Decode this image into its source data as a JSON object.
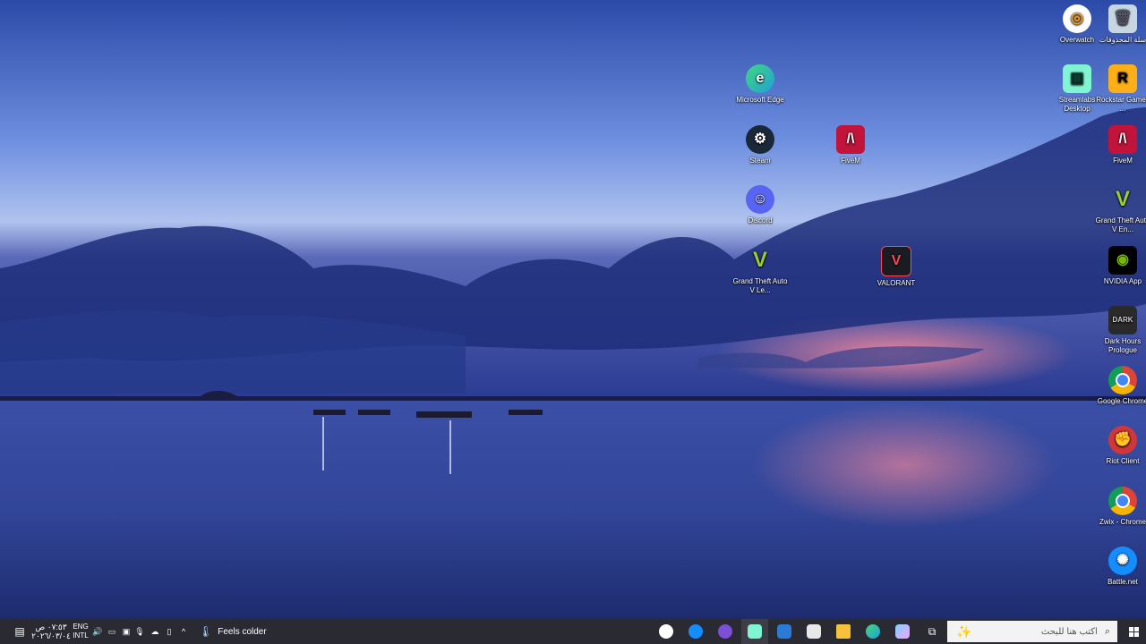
{
  "desktop_icons": [
    {
      "id": "overwatch",
      "label": "Overwatch",
      "icon": "overwatch-icon",
      "color": "#f99e1a"
    },
    {
      "id": "recycle",
      "label": "سلة المحذوفات",
      "icon": "recycle-bin-icon",
      "color": "#9fb6c8"
    },
    {
      "id": "edge",
      "label": "Microsoft Edge",
      "icon": "edge-icon",
      "color": "#1fa0d8"
    },
    {
      "id": "streamlabs",
      "label": "Streamlabs Desktop",
      "icon": "streamlabs-icon",
      "color": "#80f5d2"
    },
    {
      "id": "rockstar",
      "label": "Rockstar Games ...",
      "icon": "rockstar-icon",
      "color": "#fcaf17"
    },
    {
      "id": "steam",
      "label": "Steam",
      "icon": "steam-icon",
      "color": "#1b2838"
    },
    {
      "id": "fivem-mid",
      "label": "FiveM",
      "icon": "fivem-icon",
      "color": "#c2133a"
    },
    {
      "id": "fivem-right",
      "label": "FiveM",
      "icon": "fivem-icon",
      "color": "#c2133a"
    },
    {
      "id": "discord",
      "label": "Discord",
      "icon": "discord-icon",
      "color": "#5865f2"
    },
    {
      "id": "gta-right",
      "label": "Grand Theft Auto V En...",
      "icon": "gta-icon",
      "color": "#2b3b1a"
    },
    {
      "id": "gta-mid",
      "label": "Grand Theft Auto V Le...",
      "icon": "gta-icon",
      "color": "#2b3b1a"
    },
    {
      "id": "valorant",
      "label": "VALORANT",
      "icon": "valorant-icon",
      "color": "#ff4655"
    },
    {
      "id": "nvidia",
      "label": "NVIDIA App",
      "icon": "nvidia-icon",
      "color": "#76b900"
    },
    {
      "id": "darkhours",
      "label": "Dark Hours Prologue",
      "icon": "darkhours-icon",
      "color": "#2a2a2a"
    },
    {
      "id": "chrome",
      "label": "Google Chrome",
      "icon": "chrome-icon",
      "color": "#db4437"
    },
    {
      "id": "riot",
      "label": "Riot Client",
      "icon": "riot-icon",
      "color": "#d13639"
    },
    {
      "id": "chrome2",
      "label": "Zwix - Chrome",
      "icon": "chrome-icon",
      "color": "#db4437"
    },
    {
      "id": "battlenet",
      "label": "Battle.net",
      "icon": "battlenet-icon",
      "color": "#148eff"
    }
  ],
  "taskbar": {
    "search_placeholder": "اكتب هنا للبحث",
    "weather": "Feels colder",
    "lang_line1": "ENG",
    "lang_line2": "INTL",
    "time": "٠٧:٥٣ ص",
    "date": "٢٠٢٦/٠٣/٠٤",
    "apps": [
      {
        "name": "overwatch",
        "icon": "overwatch-icon",
        "color": "#f99e1a"
      },
      {
        "name": "battlenet",
        "icon": "battlenet-icon",
        "color": "#148eff"
      },
      {
        "name": "app-purple",
        "icon": "app-icon",
        "color": "#7b4fd6"
      },
      {
        "name": "streamlabs",
        "icon": "streamlabs-icon",
        "color": "#80f5d2"
      },
      {
        "name": "mail",
        "icon": "mail-icon",
        "color": "#2a7ad6"
      },
      {
        "name": "store",
        "icon": "store-icon",
        "color": "#e8e8e8"
      },
      {
        "name": "file-explorer",
        "icon": "folder-icon",
        "color": "#f6c23c"
      },
      {
        "name": "edge",
        "icon": "edge-icon",
        "color": "#1fa0d8"
      },
      {
        "name": "copilot",
        "icon": "copilot-icon",
        "color": "#7fd1ff"
      },
      {
        "name": "task-view",
        "icon": "task-view-icon",
        "color": "#ffffff"
      }
    ]
  }
}
